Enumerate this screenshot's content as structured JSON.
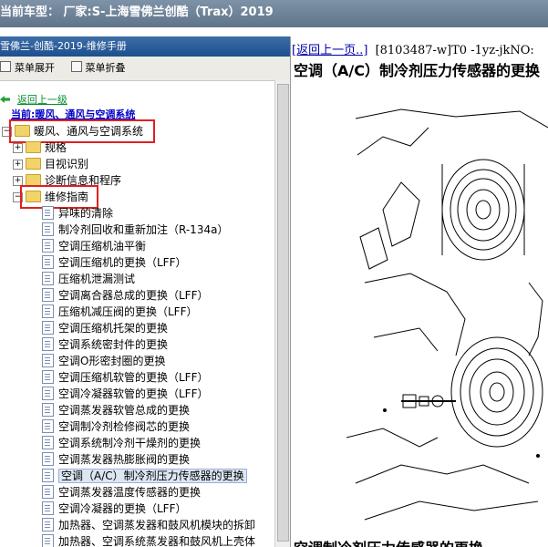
{
  "window": {
    "title": "当前车型： 厂家:S-上海雪佛兰创酷（Trax）2019"
  },
  "left_pane": {
    "header": "雪佛兰-创酷-2019-维修手册",
    "toolbar": {
      "expand_label": "菜单展开",
      "collapse_label": "菜单折叠"
    },
    "back_link": "返回上一级",
    "current_label": "当前:暖风、通风与空调系统",
    "tree": {
      "root": "暖风、通风与空调系统",
      "children": [
        "规格",
        "目视识别",
        "诊断信息和程序",
        "维修指南"
      ],
      "items": [
        "异味的清除",
        "制冷剂回收和重新加注（R-134a）",
        "空调压缩机油平衡",
        "空调压缩机的更换（LFF）",
        "压缩机泄漏测试",
        "空调离合器总成的更换（LFF）",
        "压缩机减压阀的更换（LFF）",
        "空调压缩机托架的更换",
        "空调系统密封件的更换",
        "空调O形密封圈的更换",
        "空调压缩机软管的更换（LFF）",
        "空调冷凝器软管的更换（LFF）",
        "空调蒸发器软管总成的更换",
        "空调制冷剂检修阀芯的更换",
        "空调系统制冷剂干燥剂的更换",
        "空调蒸发器热膨胀阀的更换",
        "空调（A/C）制冷剂压力传感器的更换",
        "空调蒸发器温度传感器的更换",
        "空调冷凝器的更换（LFF）",
        "加热器、空调蒸发器和鼓风机模块的拆卸",
        "加热器、空调系统蒸发器和鼓风机上壳体"
      ],
      "selected_index": 16
    }
  },
  "right_pane": {
    "back_link": "[返回上一页..]",
    "doc_code": "[8103487-w]T0 -1yz-jkNO:",
    "title": "空调（A/C）制冷剂压力传感器的更换",
    "bottom_heading": "空调制冷剂压力传感器的更换"
  }
}
